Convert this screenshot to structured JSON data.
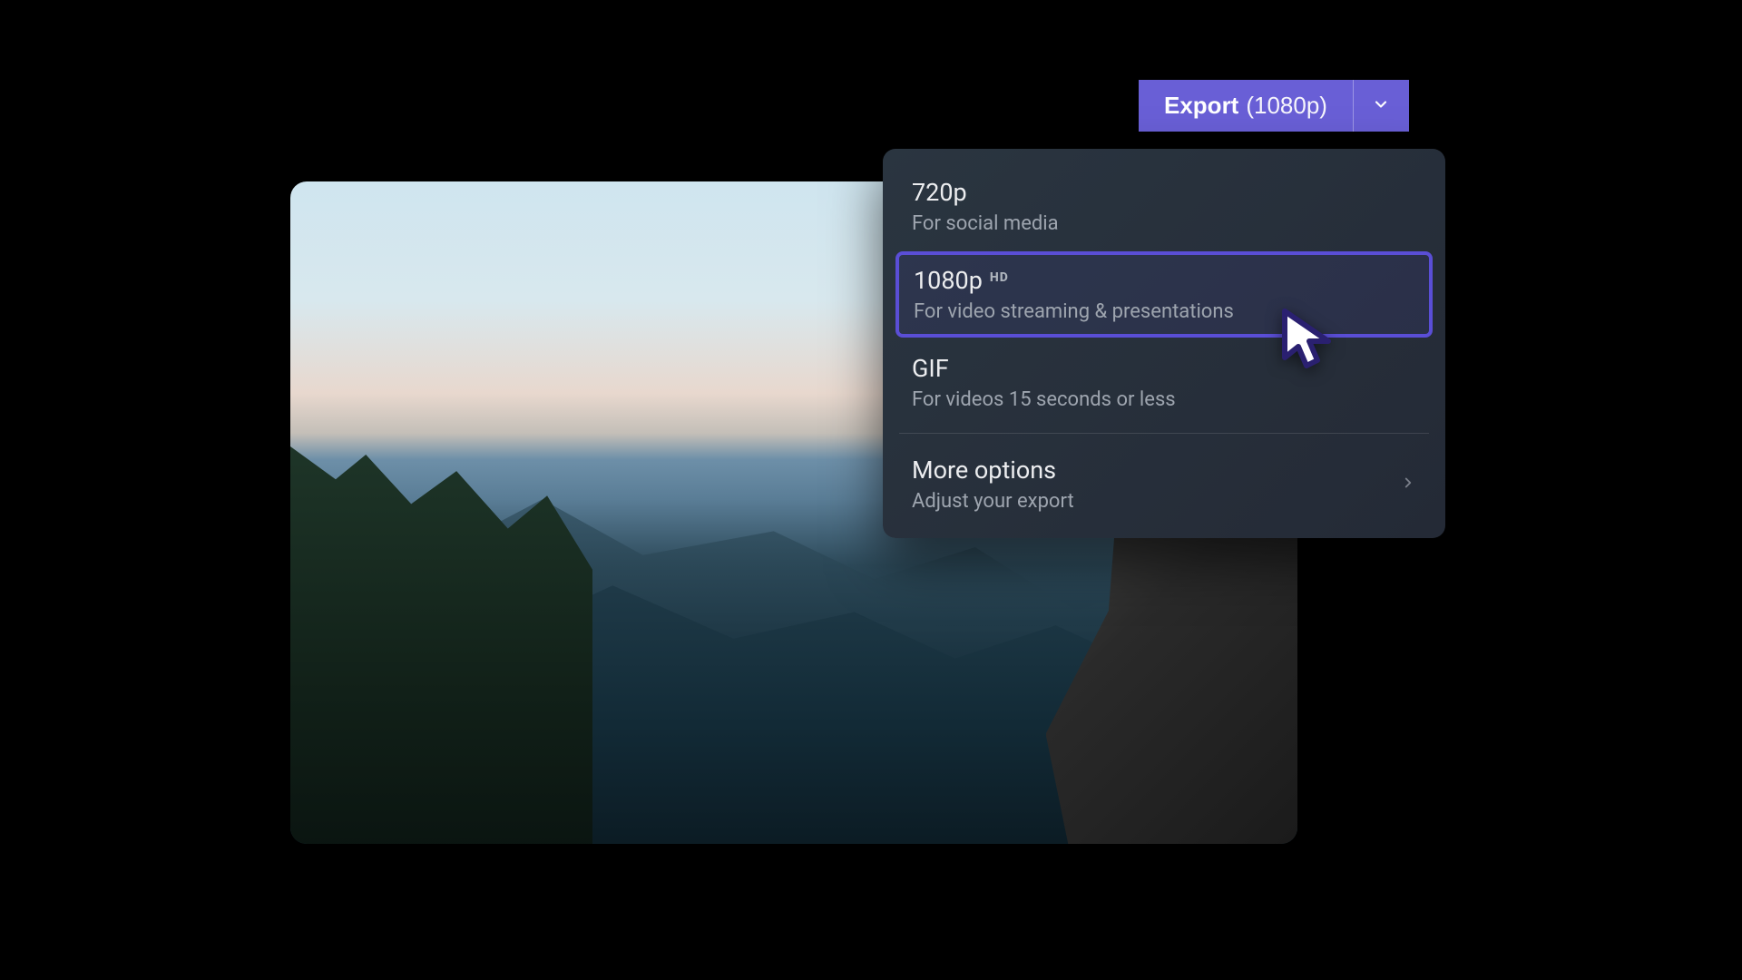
{
  "export_button": {
    "label": "Export",
    "detail": "(1080p)"
  },
  "dropdown": {
    "items": [
      {
        "title": "720p",
        "badge": "",
        "subtitle": "For social media",
        "selected": false
      },
      {
        "title": "1080p",
        "badge": "HD",
        "subtitle": "For video streaming & presentations",
        "selected": true
      },
      {
        "title": "GIF",
        "badge": "",
        "subtitle": "For videos 15 seconds or less",
        "selected": false
      }
    ],
    "more": {
      "title": "More options",
      "subtitle": "Adjust your export"
    }
  },
  "colors": {
    "accent": "#695fd6",
    "dropdown_bg": "#2a3540",
    "selection_border": "#5a4ed6"
  }
}
